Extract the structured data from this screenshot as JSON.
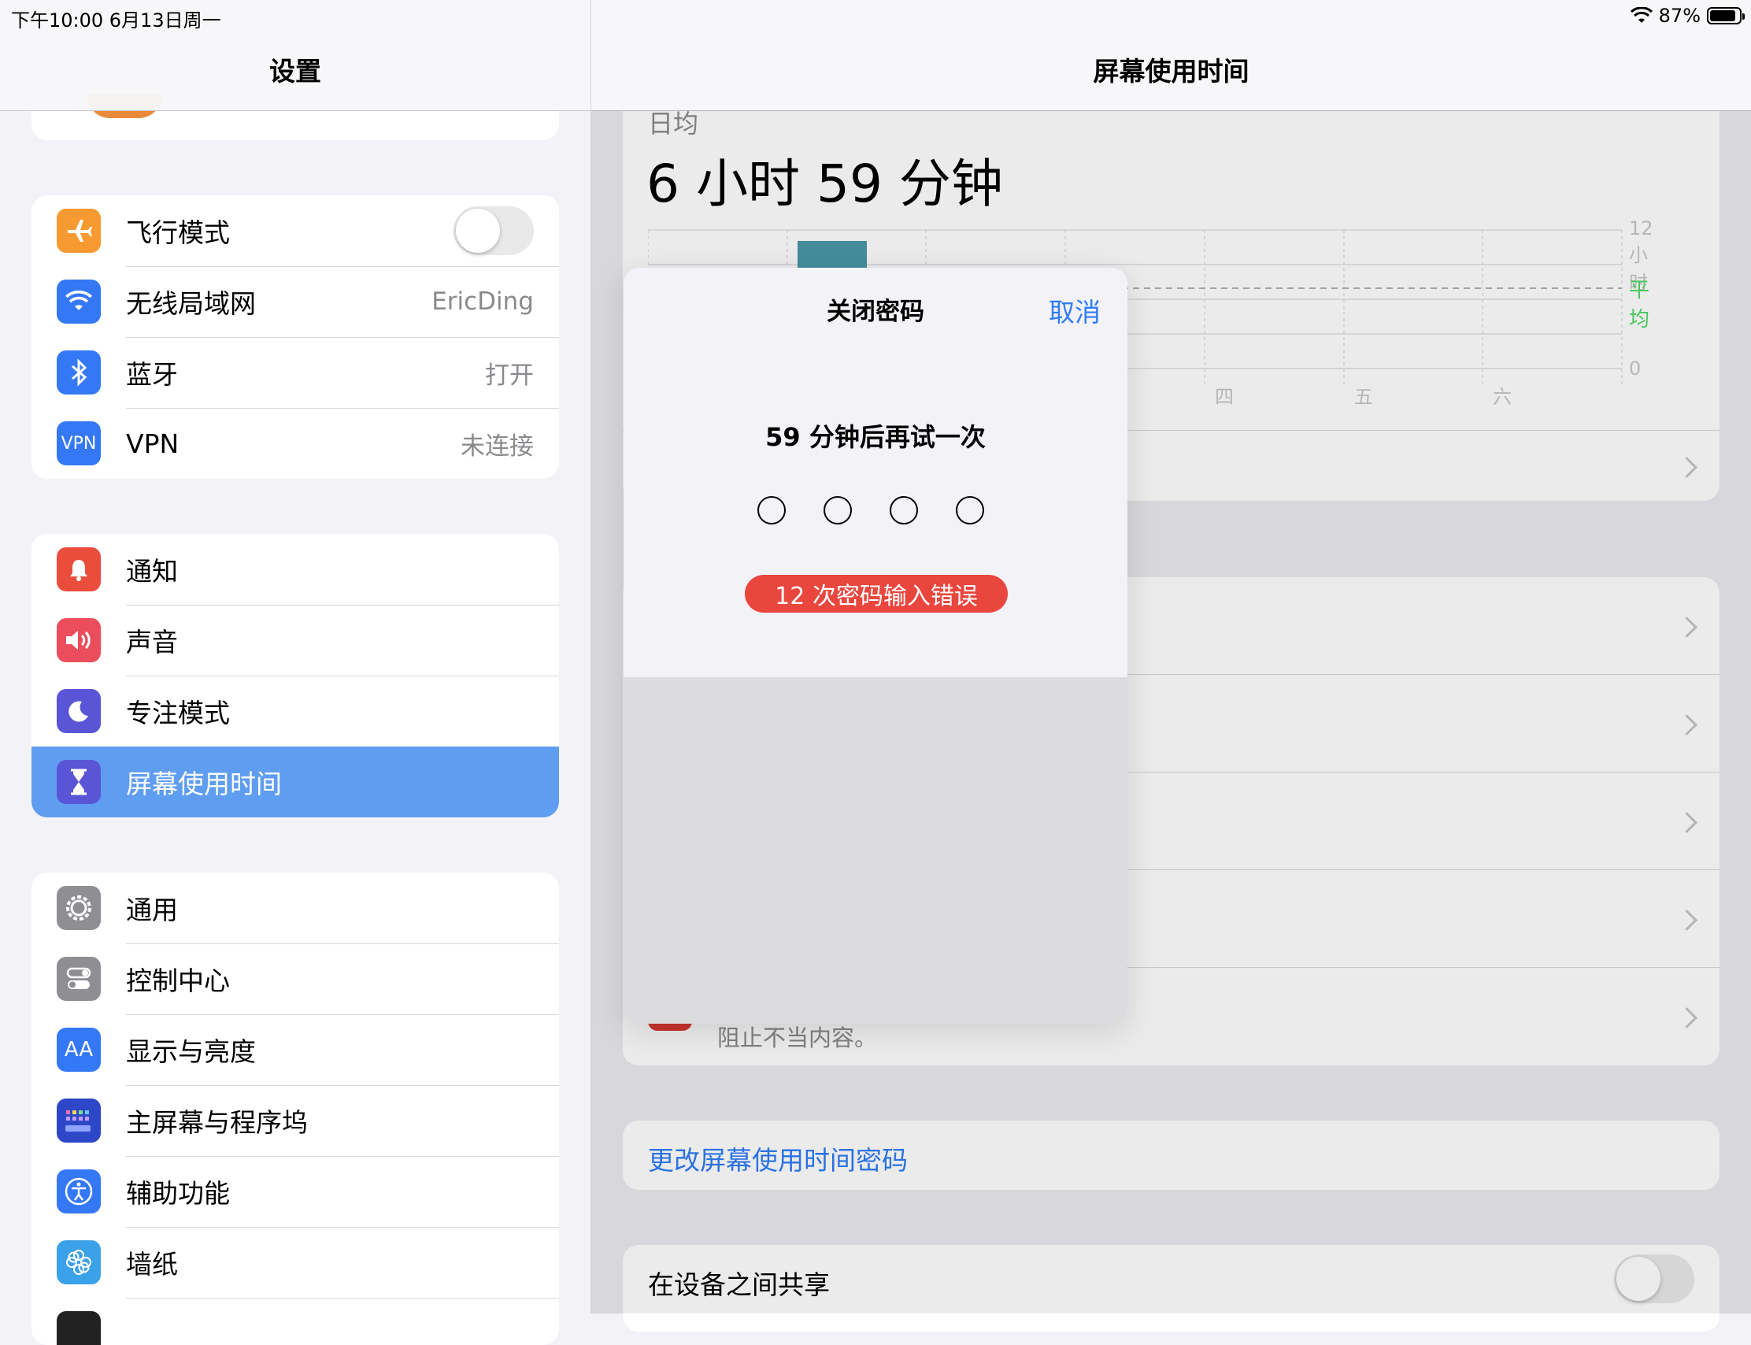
{
  "status": {
    "time": "下午10:00   6月13日周一",
    "battery": "87%"
  },
  "left": {
    "title": "设置",
    "group1": [
      {
        "label": "飞行模式",
        "icon": "airplane-icon",
        "color": "#f79a32",
        "type": "toggle"
      },
      {
        "label": "无线局域网",
        "icon": "wifi-icon",
        "color": "#3478f6",
        "value": "EricDing"
      },
      {
        "label": "蓝牙",
        "icon": "bluetooth-icon",
        "color": "#3478f6",
        "value": "打开"
      },
      {
        "label": "VPN",
        "icon": "vpn-icon",
        "color": "#3478f6",
        "value": "未连接",
        "icon_text": "VPN"
      }
    ],
    "group2": [
      {
        "label": "通知",
        "icon": "notification-icon",
        "color": "#eb4d3d"
      },
      {
        "label": "声音",
        "icon": "sound-icon",
        "color": "#eb4d5d"
      },
      {
        "label": "专注模式",
        "icon": "moon-icon",
        "color": "#5a55d6"
      },
      {
        "label": "屏幕使用时间",
        "icon": "hourglass-icon",
        "color": "#5a55d6"
      }
    ],
    "group3": [
      {
        "label": "通用",
        "icon": "gear-icon",
        "color": "#8e8e93"
      },
      {
        "label": "控制中心",
        "icon": "toggles-icon",
        "color": "#8e8e93"
      },
      {
        "label": "显示与亮度",
        "icon": "text-size-icon",
        "color": "#3478f6",
        "icon_text": "AA"
      },
      {
        "label": "主屏幕与程序坞",
        "icon": "homescreen-icon",
        "color": "#2d47c8"
      },
      {
        "label": "辅助功能",
        "icon": "accessibility-icon",
        "color": "#3478f6"
      },
      {
        "label": "墙纸",
        "icon": "wallpaper-icon",
        "color": "#3ba1e8"
      }
    ]
  },
  "right": {
    "title": "屏幕使用时间",
    "daily_label": "日均",
    "daily_value": "6 小时 59 分钟",
    "chart": {
      "ymax_label": "12 小时",
      "avg_label": "平均",
      "zero_label": "0",
      "days": [
        "四",
        "五",
        "六"
      ]
    },
    "content_snippet": "阻止不当内容。",
    "change_passcode": "更改屏幕使用时间密码",
    "share_devices": "在设备之间共享"
  },
  "modal": {
    "title": "关闭密码",
    "cancel": "取消",
    "message": "59 分钟后再试一次",
    "error": "12 次密码输入错误"
  },
  "colors": {
    "accent": "#2f7cf6",
    "selected": "#5f9df0",
    "error": "#e9463d",
    "avg": "#4cd964",
    "bar": "#4a98a8"
  }
}
